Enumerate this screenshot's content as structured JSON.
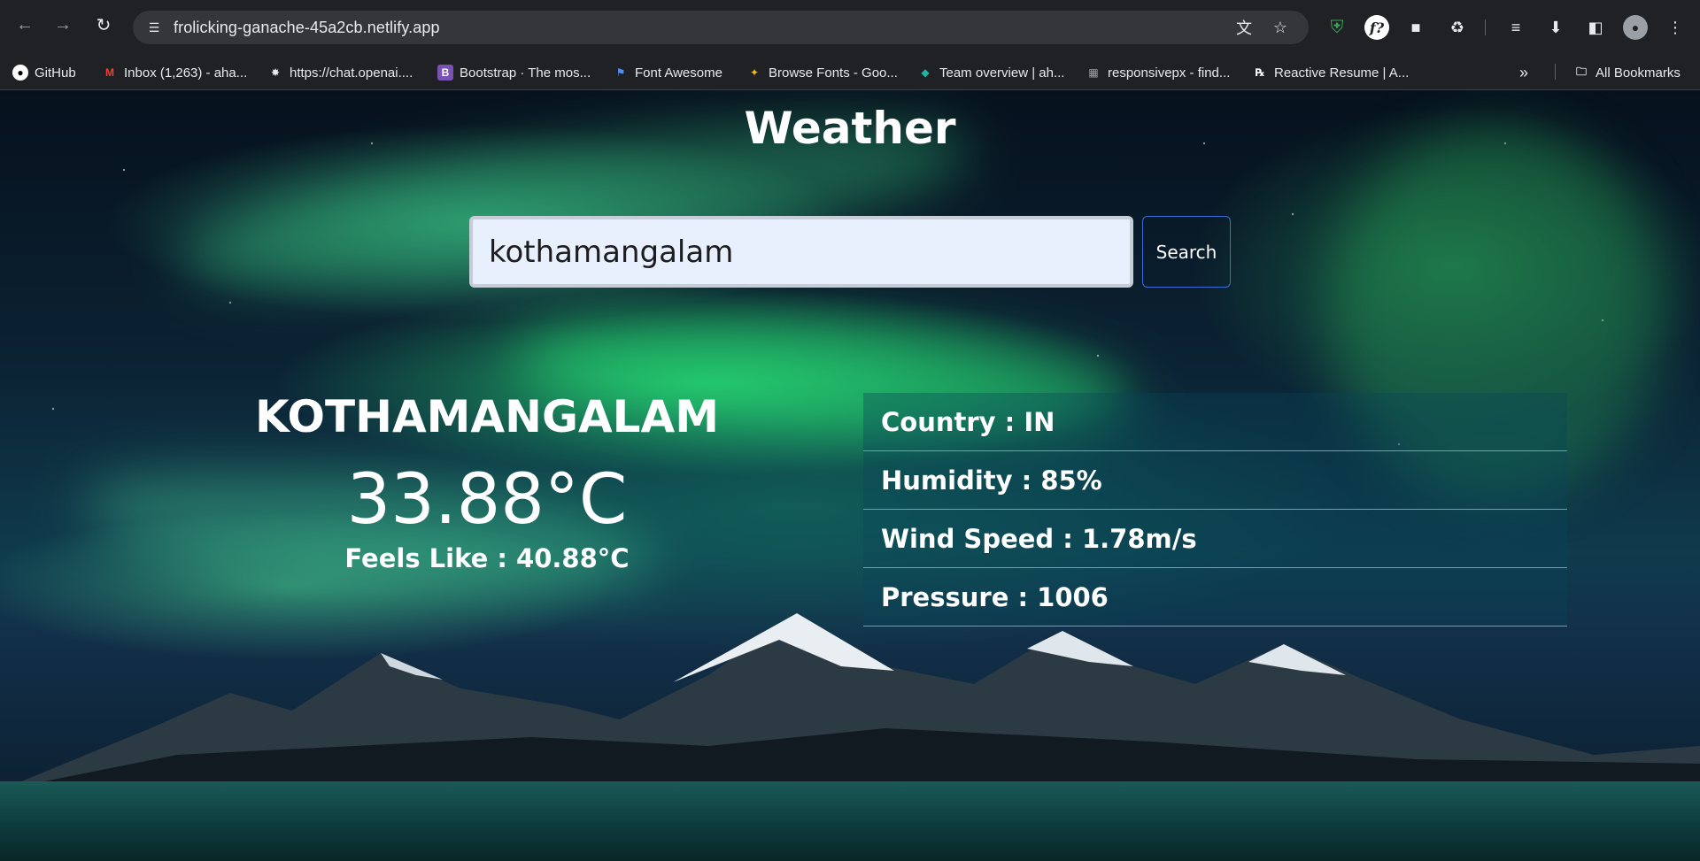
{
  "browser": {
    "url": "frolicking-ganache-45a2cb.netlify.app",
    "bookmarks": [
      {
        "label": "GitHub",
        "icon": "github-icon"
      },
      {
        "label": "Inbox (1,263) - aha...",
        "icon": "gmail-icon"
      },
      {
        "label": "https://chat.openai....",
        "icon": "openai-icon"
      },
      {
        "label": "Bootstrap · The mos...",
        "icon": "bootstrap-icon"
      },
      {
        "label": "Font Awesome",
        "icon": "flag-icon"
      },
      {
        "label": "Browse Fonts - Goo...",
        "icon": "google-fonts-icon"
      },
      {
        "label": "Team overview | ah...",
        "icon": "diamond-icon"
      },
      {
        "label": "responsivepx - find...",
        "icon": "responsivepx-icon"
      },
      {
        "label": "Reactive Resume | A...",
        "icon": "rx-icon"
      }
    ],
    "all_bookmarks_label": "All Bookmarks"
  },
  "app": {
    "title": "Weather",
    "search": {
      "value": "kothamangalam",
      "button_label": "Search"
    },
    "current": {
      "city": "KOTHAMANGALAM",
      "temperature": "33.88°C",
      "feels_like": "Feels Like : 40.88°C"
    },
    "details": [
      "Country : IN",
      "Humidity : 85%",
      "Wind Speed : 1.78m/s",
      "Pressure : 1006"
    ]
  },
  "colors": {
    "chrome_bg": "#202124",
    "omnibox_bg": "#35363a",
    "input_bg": "#e8f0fe",
    "button_border": "#3b6bd6",
    "row_divider": "#35b5d8",
    "text": "#ffffff"
  }
}
